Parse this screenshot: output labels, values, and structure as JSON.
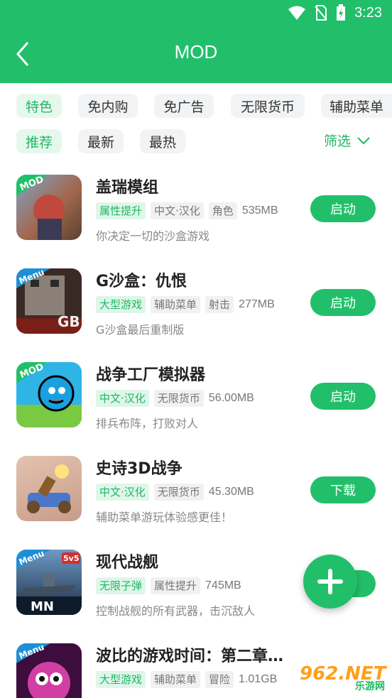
{
  "status": {
    "time": "3:23"
  },
  "header": {
    "title": "MOD"
  },
  "category_tabs": [
    "特色",
    "免内购",
    "免广告",
    "无限货币",
    "辅助菜单"
  ],
  "sort_tabs": [
    "推荐",
    "最新",
    "最热"
  ],
  "filter_label": "筛选",
  "apps": [
    {
      "name": "盖瑞模组",
      "tags": [
        {
          "text": "属性提升",
          "green": true
        },
        {
          "text": "中文·汉化",
          "green": false
        },
        {
          "text": "角色",
          "green": false
        }
      ],
      "size": "535MB",
      "desc": "你决定一切的沙盒游戏",
      "action": "启动",
      "badge": "MOD"
    },
    {
      "name": "G沙盒：仇恨",
      "tags": [
        {
          "text": "大型游戏",
          "green": true
        },
        {
          "text": "辅助菜单",
          "green": false
        },
        {
          "text": "射击",
          "green": false
        }
      ],
      "size": "277MB",
      "desc": "G沙盒最后重制版",
      "action": "启动",
      "badge": "Menu"
    },
    {
      "name": "战争工厂模拟器",
      "tags": [
        {
          "text": "中文·汉化",
          "green": true
        },
        {
          "text": "无限货币",
          "green": false
        }
      ],
      "size": "56.00MB",
      "desc": "排兵布阵，打败对人",
      "action": "启动",
      "badge": "MOD"
    },
    {
      "name": "史诗3D战争",
      "tags": [
        {
          "text": "中文·汉化",
          "green": true
        },
        {
          "text": "无限货币",
          "green": false
        }
      ],
      "size": "45.30MB",
      "desc": "辅助菜单游玩体验感更佳！",
      "action": "下载",
      "badge": ""
    },
    {
      "name": "现代战舰",
      "tags": [
        {
          "text": "无限子弹",
          "green": true
        },
        {
          "text": "属性提升",
          "green": false
        }
      ],
      "size": "745MB",
      "desc": "控制战舰的所有武器，击沉敌人",
      "action": "",
      "badge": "Menu"
    },
    {
      "name": "波比的游戏时间：第二章…",
      "tags": [
        {
          "text": "大型游戏",
          "green": true
        },
        {
          "text": "辅助菜单",
          "green": false
        },
        {
          "text": "冒险",
          "green": false
        }
      ],
      "size": "1.01GB",
      "desc": "",
      "action": "",
      "badge": "Menu"
    }
  ],
  "watermark": {
    "main": "962.NET",
    "sub": "乐游网"
  },
  "colors": {
    "primary": "#22bf6a",
    "chip_active_bg": "#e6f8ee"
  }
}
